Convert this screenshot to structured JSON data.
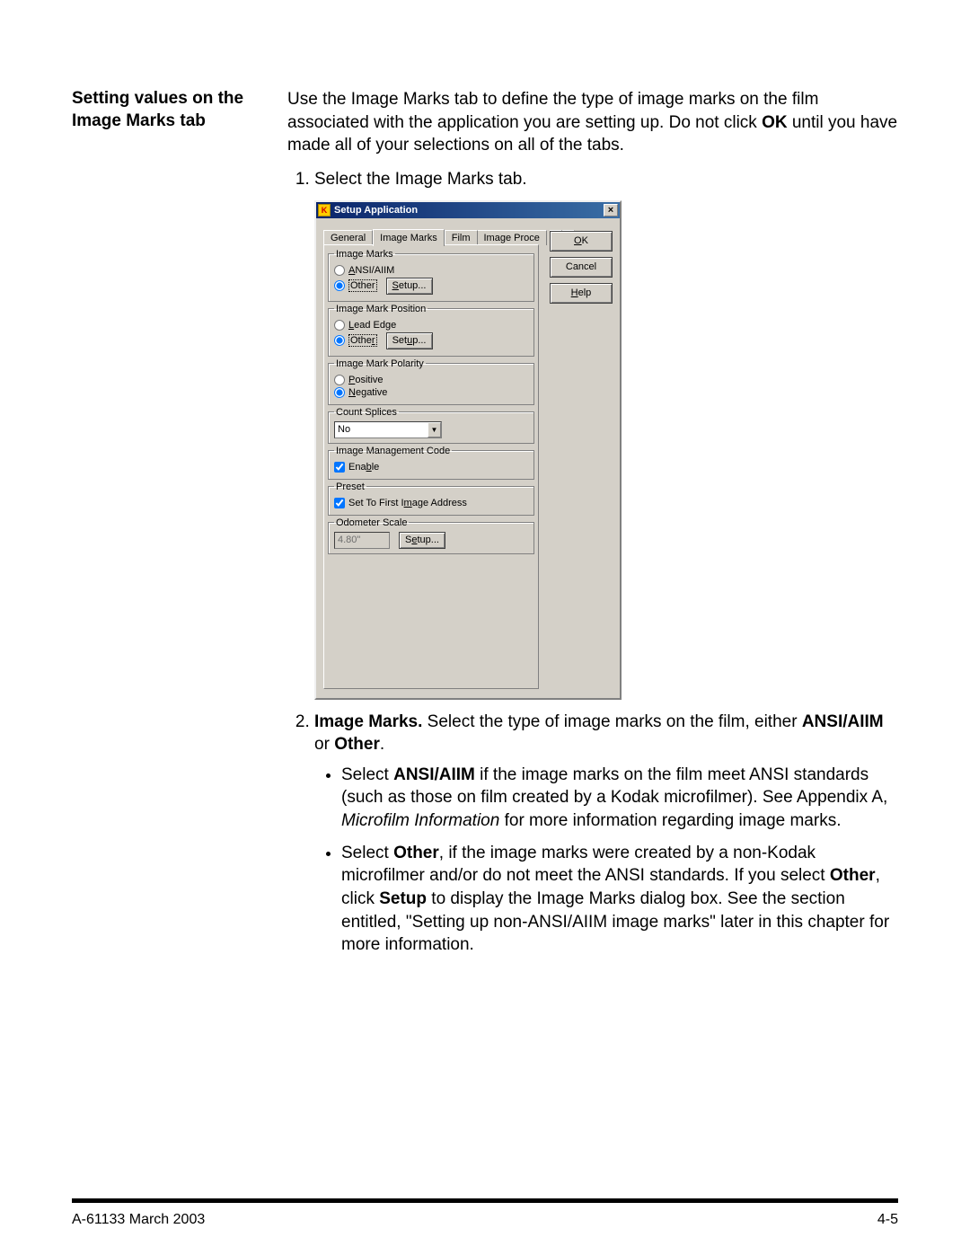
{
  "section_heading": "Setting values on the Image Marks tab",
  "intro_parts": {
    "a": "Use the Image Marks tab to define the type of image marks on the film associated with the application you are setting up. Do not click ",
    "b_bold": "OK",
    "c": " until you have made all of your selections on all of the tabs."
  },
  "steps": {
    "s1": "Select the Image Marks tab.",
    "s2": {
      "a_bold": "Image Marks.",
      "b": " Select the type of image marks on the film, either ",
      "c_bold": "ANSI/AIIM",
      "d": " or ",
      "e_bold": "Other",
      "f": "."
    }
  },
  "bullets": {
    "b1": {
      "a": "Select ",
      "b_bold": "ANSI/AIIM",
      "c": " if the image marks on the film meet ANSI standards (such as those on film created by a Kodak microfilmer). See Appendix A, ",
      "d_italic": "Microfilm Information",
      "e": " for more information regarding image marks."
    },
    "b2": {
      "a": "Select ",
      "b_bold": "Other",
      "c": ", if the image marks were created by a non-Kodak microfilmer and/or do not meet the ANSI standards.  If you select ",
      "d_bold": "Other",
      "e": ", click ",
      "f_bold": "Setup",
      "g": " to display the Image Marks dialog box. See the section entitled, \"Setting up non-ANSI/AIIM image marks\" later in this chapter for more information."
    }
  },
  "dialog": {
    "title": "Setup Application",
    "tabs": {
      "general": "General",
      "image_marks": "Image Marks",
      "film": "Film",
      "image_proce": "Image Proce"
    },
    "buttons": {
      "ok": "OK",
      "cancel": "Cancel",
      "help": "Help"
    },
    "groups": {
      "image_marks": {
        "legend": "Image Marks",
        "opt_ansi_u": "A",
        "opt_ansi_rest": "NSI/AIIM",
        "opt_other": "Other",
        "setup_u": "S",
        "setup_rest": "etup..."
      },
      "position": {
        "legend": "Image Mark Position",
        "opt_lead_u": "L",
        "opt_lead_rest": "ead Edge",
        "opt_other_pre": "Othe",
        "opt_other_u": "r",
        "setup_pre": "Set",
        "setup_u": "u",
        "setup_post": "p..."
      },
      "polarity": {
        "legend": "Image Mark Polarity",
        "opt_pos_u": "P",
        "opt_pos_rest": "ositive",
        "opt_neg_u": "N",
        "opt_neg_rest": "egative"
      },
      "count_splices": {
        "legend": "Count Splices",
        "value": "No"
      },
      "mgmt": {
        "legend": "Image Management Code",
        "enable_pre": "Ena",
        "enable_u": "b",
        "enable_post": "le"
      },
      "preset": {
        "legend": "Preset",
        "label_pre": "Set To First I",
        "label_u": "m",
        "label_post": "age Address"
      },
      "odometer": {
        "legend": "Odometer Scale",
        "value": "4.80\"",
        "setup_pre": "S",
        "setup_u": "e",
        "setup_post": "tup..."
      }
    }
  },
  "footer": {
    "left": "A-61133  March 2003",
    "right": "4-5"
  }
}
